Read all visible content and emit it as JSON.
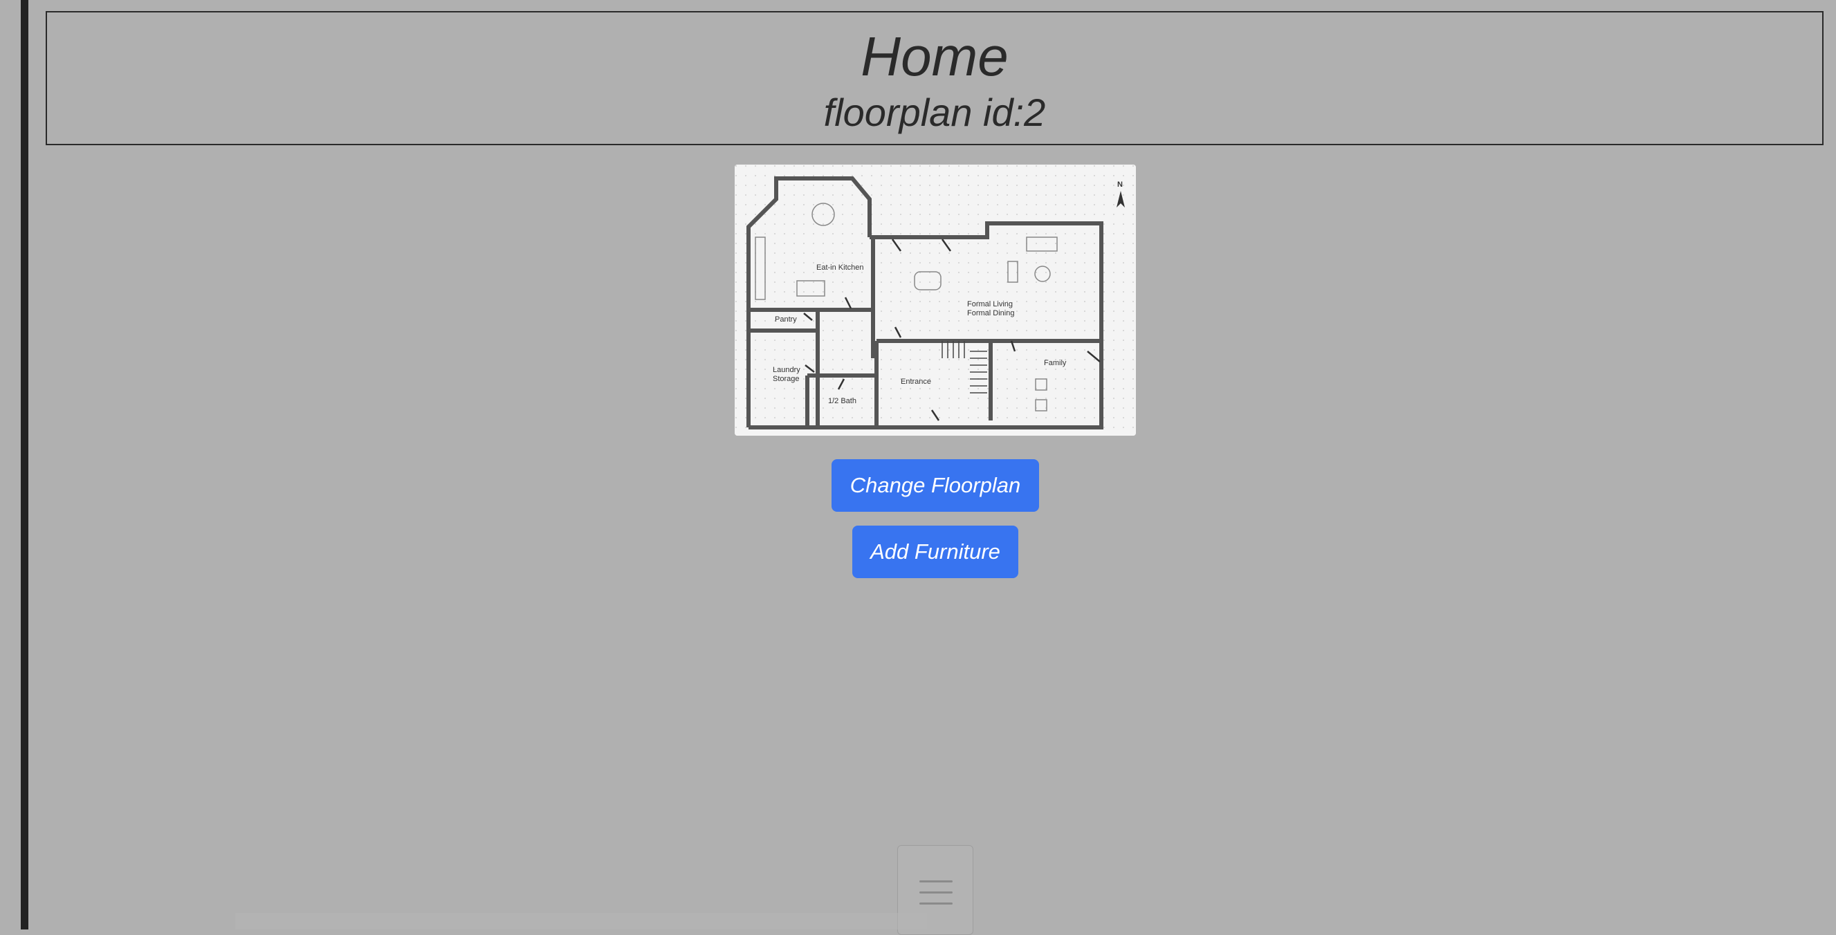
{
  "header": {
    "title": "Home",
    "subtitle": "floorplan id:2"
  },
  "floorplan": {
    "rooms": {
      "eat_in_kitchen": "Eat-in Kitchen",
      "pantry": "Pantry",
      "laundry_storage_1": "Laundry",
      "laundry_storage_2": "Storage",
      "half_bath": "1/2 Bath",
      "entrance": "Entrance",
      "formal_living": "Formal Living",
      "formal_dining": "Formal Dining",
      "family": "Family",
      "north": "N"
    }
  },
  "actions": {
    "change_floorplan": "Change Floorplan",
    "add_furniture": "Add Furniture"
  },
  "colors": {
    "background": "#b0b0b0",
    "button": "#3874f0",
    "button_text": "#ffffff",
    "text": "#2a2a2a"
  },
  "icons": {
    "menu": "hamburger-menu-icon"
  }
}
